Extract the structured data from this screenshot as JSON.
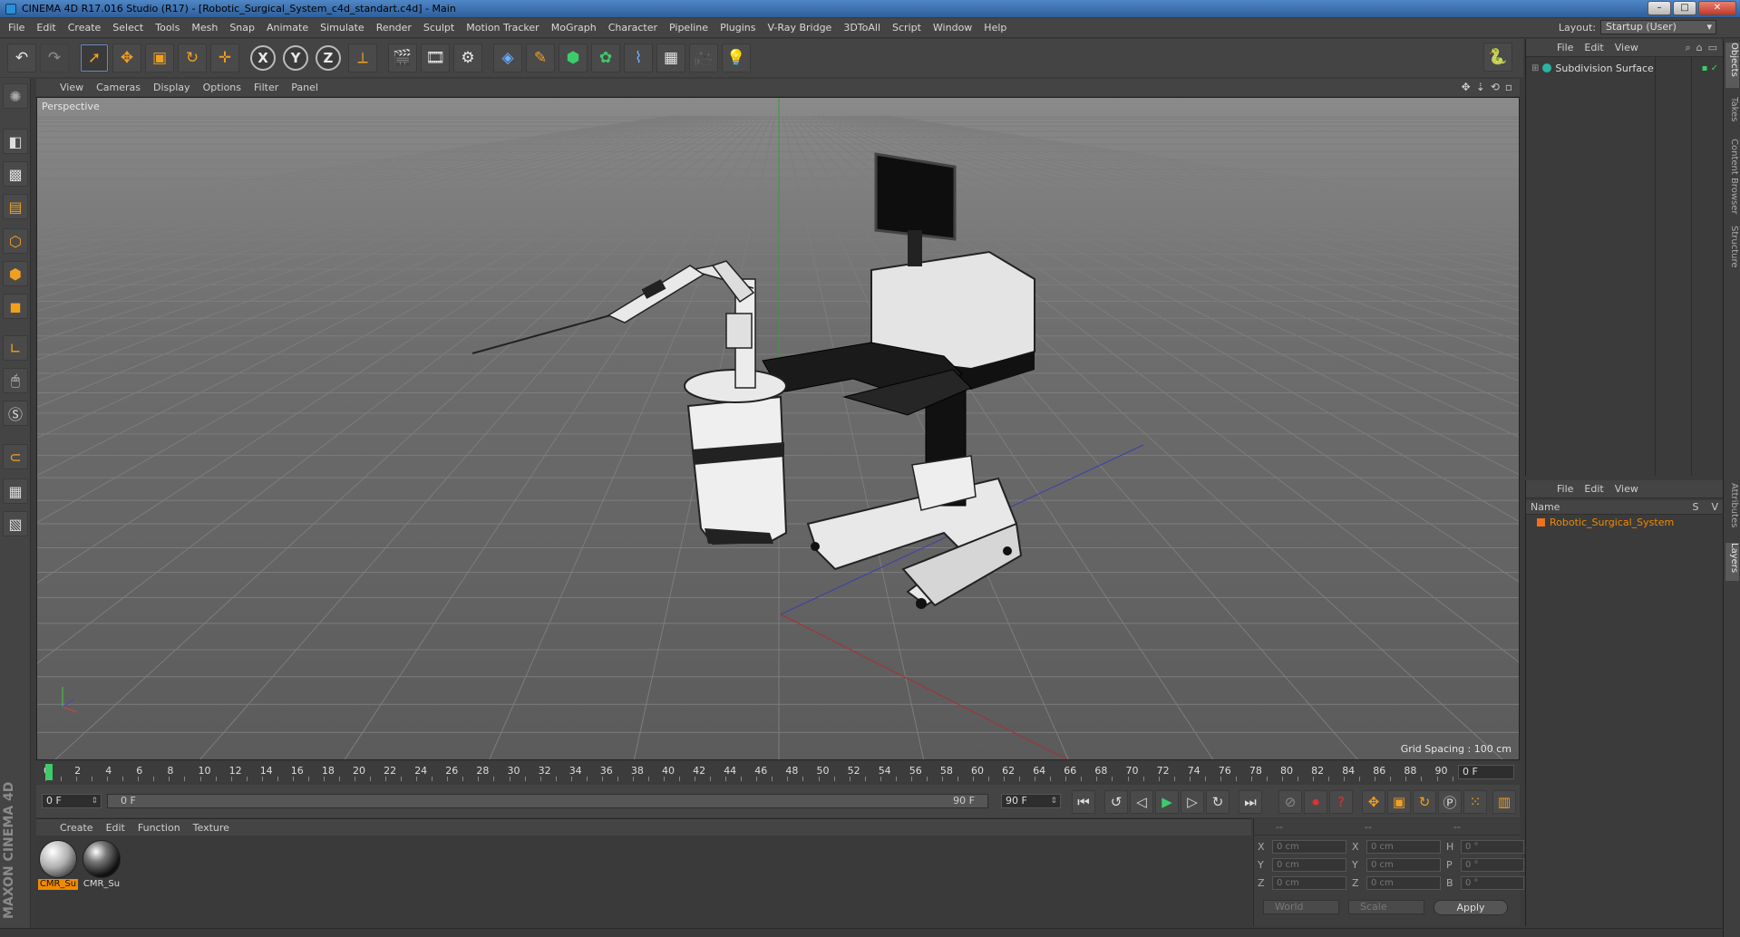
{
  "window": {
    "title": "CINEMA 4D R17.016 Studio (R17) - [Robotic_Surgical_System_c4d_standart.c4d] - Main",
    "minimize": "–",
    "maximize": "□",
    "close": "✕"
  },
  "menu": [
    "File",
    "Edit",
    "Create",
    "Select",
    "Tools",
    "Mesh",
    "Snap",
    "Animate",
    "Simulate",
    "Render",
    "Sculpt",
    "Motion Tracker",
    "MoGraph",
    "Character",
    "Pipeline",
    "Plugins",
    "V-Ray Bridge",
    "3DToAll",
    "Script",
    "Window",
    "Help"
  ],
  "layout": {
    "label": "Layout:",
    "value": "Startup (User)"
  },
  "toolbar": {
    "axis_x": "X",
    "axis_y": "Y",
    "axis_z": "Z"
  },
  "viewport": {
    "menu": [
      "View",
      "Cameras",
      "Display",
      "Options",
      "Filter",
      "Panel"
    ],
    "label": "Perspective",
    "grid_spacing": "Grid Spacing : 100 cm"
  },
  "timeline": {
    "ticks": [
      "0",
      "2",
      "4",
      "6",
      "8",
      "10",
      "12",
      "14",
      "16",
      "18",
      "20",
      "22",
      "24",
      "26",
      "28",
      "30",
      "32",
      "34",
      "36",
      "38",
      "40",
      "42",
      "44",
      "46",
      "48",
      "50",
      "52",
      "54",
      "56",
      "58",
      "60",
      "62",
      "64",
      "66",
      "68",
      "70",
      "72",
      "74",
      "76",
      "78",
      "80",
      "82",
      "84",
      "86",
      "88",
      "90"
    ],
    "current_frame": "0 F"
  },
  "playback": {
    "start_field": "0 F",
    "range_start": "0 F",
    "range_end": "90 F",
    "end_field": "90 F"
  },
  "materials": {
    "menu": [
      "Create",
      "Edit",
      "Function",
      "Texture"
    ],
    "items": [
      {
        "name": "CMR_Su",
        "selected": true
      },
      {
        "name": "CMR_Su",
        "selected": false
      }
    ]
  },
  "coordinates": {
    "header": [
      "--",
      "--",
      "--"
    ],
    "rows": [
      {
        "l1": "X",
        "v1": "0 cm",
        "l2": "X",
        "v2": "0 cm",
        "l3": "H",
        "v3": "0 °"
      },
      {
        "l1": "Y",
        "v1": "0 cm",
        "l2": "Y",
        "v2": "0 cm",
        "l3": "P",
        "v3": "0 °"
      },
      {
        "l1": "Z",
        "v1": "0 cm",
        "l2": "Z",
        "v2": "0 cm",
        "l3": "B",
        "v3": "0 °"
      }
    ],
    "coord_system": "World",
    "mode": "Scale",
    "apply": "Apply"
  },
  "object_manager": {
    "menu": [
      "File",
      "Edit",
      "View"
    ],
    "object": "Subdivision Surface"
  },
  "layer_manager": {
    "menu": [
      "File",
      "Edit",
      "View"
    ],
    "col_name": "Name",
    "col_s": "S",
    "col_v": "V",
    "object": "Robotic_Surgical_System"
  },
  "right_tabs": [
    "Objects",
    "Takes",
    "Content Browser",
    "Structure",
    "Attributes",
    "Layers"
  ],
  "brand": "MAXON CINEMA 4D",
  "colors": {
    "accent": "#f08a00",
    "playhead": "#3ecb6a",
    "selection_blue": "#6a8bc0"
  }
}
